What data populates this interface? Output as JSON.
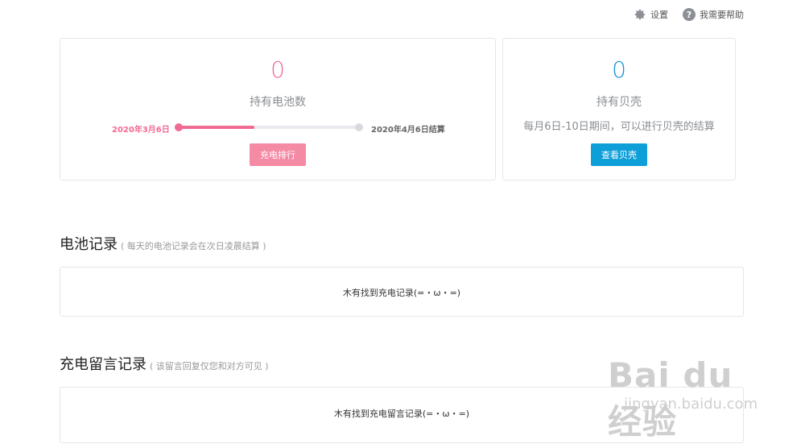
{
  "header": {
    "settings_label": "设置",
    "help_label": "我需要帮助",
    "help_icon_glyph": "?"
  },
  "battery_card": {
    "count": "0",
    "label": "持有电池数",
    "start_date": "2020年3月6日",
    "end_date": "2020年4月6日结算",
    "progress": 0.42,
    "button_label": "充电排行"
  },
  "shell_card": {
    "count": "0",
    "label": "持有贝壳",
    "note": "每月6日-10日期间，可以进行贝壳的结算",
    "button_label": "查看贝壳"
  },
  "battery_record": {
    "title": "电池记录",
    "subtitle": "( 每天的电池记录会在次日凌晨结算 )",
    "empty_text": "木有找到充电记录(=・ω・=)"
  },
  "message_record": {
    "title": "充电留言记录",
    "subtitle": "( 该留言回复仅您和对方可见 )",
    "empty_text": "木有找到充电留言记录(=・ω・=)"
  },
  "watermark": {
    "brand": "Bai du 经验",
    "url": "jingyan.baidu.com"
  },
  "colors": {
    "pink": "#f06b93",
    "blue": "#1896d7"
  }
}
